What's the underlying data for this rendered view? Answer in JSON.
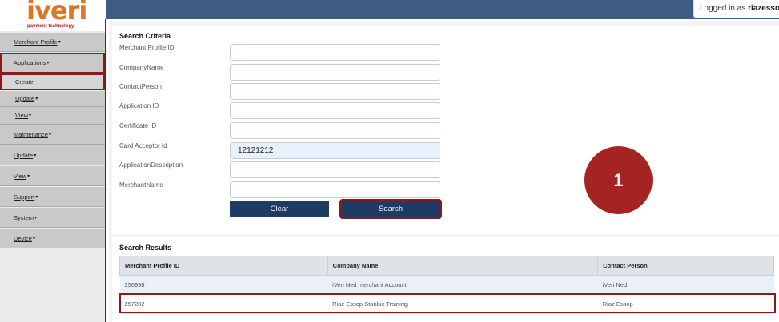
{
  "logo": {
    "text": "iveri",
    "tagline": "payment technology"
  },
  "header": {
    "logged_in_prefix": "Logged in as",
    "username": "riazessop"
  },
  "sidebar": {
    "items": [
      {
        "label": "Merchant Profile",
        "caret": "▾"
      },
      {
        "label": "Applications",
        "caret": "▾"
      },
      {
        "label": "Create",
        "caret": ""
      },
      {
        "label": "Update",
        "caret": "▾"
      },
      {
        "label": "View",
        "caret": "▾"
      },
      {
        "label": "Maintenance",
        "caret": "▾"
      },
      {
        "label": "Update",
        "caret": "▾"
      },
      {
        "label": "View",
        "caret": "▾"
      },
      {
        "label": "Support",
        "caret": "▾"
      },
      {
        "label": "System",
        "caret": "▾"
      },
      {
        "label": "Device",
        "caret": "▾"
      }
    ]
  },
  "search": {
    "title": "Search Criteria",
    "fields": [
      {
        "label": "Merchant Profile ID",
        "value": ""
      },
      {
        "label": "CompanyName",
        "value": ""
      },
      {
        "label": "ContactPerson",
        "value": ""
      },
      {
        "label": "Application ID",
        "value": ""
      },
      {
        "label": "Certificate ID",
        "value": ""
      },
      {
        "label": "Card Acceptor Id",
        "value": "12121212"
      },
      {
        "label": "ApplicationDescription",
        "value": ""
      },
      {
        "label": "MerchantName",
        "value": ""
      }
    ],
    "clear_label": "Clear",
    "search_label": "Search"
  },
  "step_badge": "1",
  "results": {
    "title": "Search Results",
    "columns": [
      "Merchant Profile ID",
      "Company Name",
      "Contact Person"
    ],
    "rows": [
      [
        "256998",
        "iVeri Ned merchant Account",
        "iVeri Ned"
      ],
      [
        "257202",
        "Riaz Essop Stanbic Training",
        "Riaz Essop"
      ]
    ]
  },
  "colors": {
    "header_blue": "#3f5d84",
    "button_navy": "#1e3b63",
    "highlight_red": "#8b1a1a",
    "badge_red": "#a52422",
    "logo_orange": "#e07426"
  }
}
